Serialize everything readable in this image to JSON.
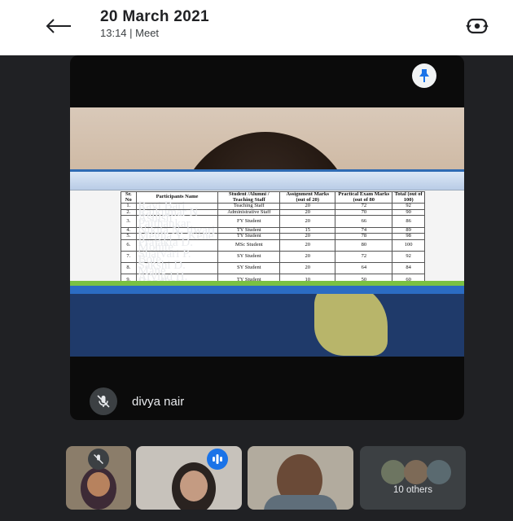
{
  "header": {
    "title": "20 March 2021",
    "subtitle": "13:14 | Meet",
    "back_icon": "back-arrow-icon",
    "rotate_icon": "switch-camera-icon"
  },
  "main": {
    "participant_name": "divya nair",
    "pin_icon": "pin-icon",
    "mic_icon": "mic-off-icon"
  },
  "shared_sheet": {
    "headers": [
      "Sr. No",
      "Participants Name",
      "Student /Alumni / Teaching Staff",
      "Assignment Marks (out of 20)",
      "Practical Exam Marks (out of 80",
      "Total (out of 100)"
    ],
    "rows": [
      [
        "1.",
        "Ravi Bari",
        "Teaching Staff",
        "20",
        "72",
        "92"
      ],
      [
        "2.",
        "Rajkumar N",
        "Administrative Staff",
        "20",
        "70",
        "90"
      ],
      [
        "3.",
        "Ashish Paithankar",
        "FY Student",
        "20",
        "66",
        "86"
      ],
      [
        "4.",
        "Nikita N. tiwari",
        "TY Student",
        "15",
        "74",
        "89"
      ],
      [
        "5.",
        "Megha Y. Kene",
        "TY Student",
        "20",
        "78",
        "98"
      ],
      [
        "6.",
        "Prajakta D. Mohite",
        "MSc Student",
        "20",
        "80",
        "100"
      ],
      [
        "7.",
        "Sharvari P. Bote",
        "SY Student",
        "20",
        "72",
        "92"
      ],
      [
        "8.",
        "Sakshi D. Mane",
        "SY Student",
        "20",
        "64",
        "84"
      ],
      [
        "9.",
        "Arvind H. Bondkar",
        "TY Student",
        "10",
        "50",
        "60"
      ]
    ]
  },
  "thumbnails": {
    "others_label": "10 others"
  },
  "colors": {
    "stage_bg": "#202124",
    "tile_bg": "#0b0b0b",
    "accent": "#1a73e8",
    "icon_bg": "#3c4043"
  }
}
